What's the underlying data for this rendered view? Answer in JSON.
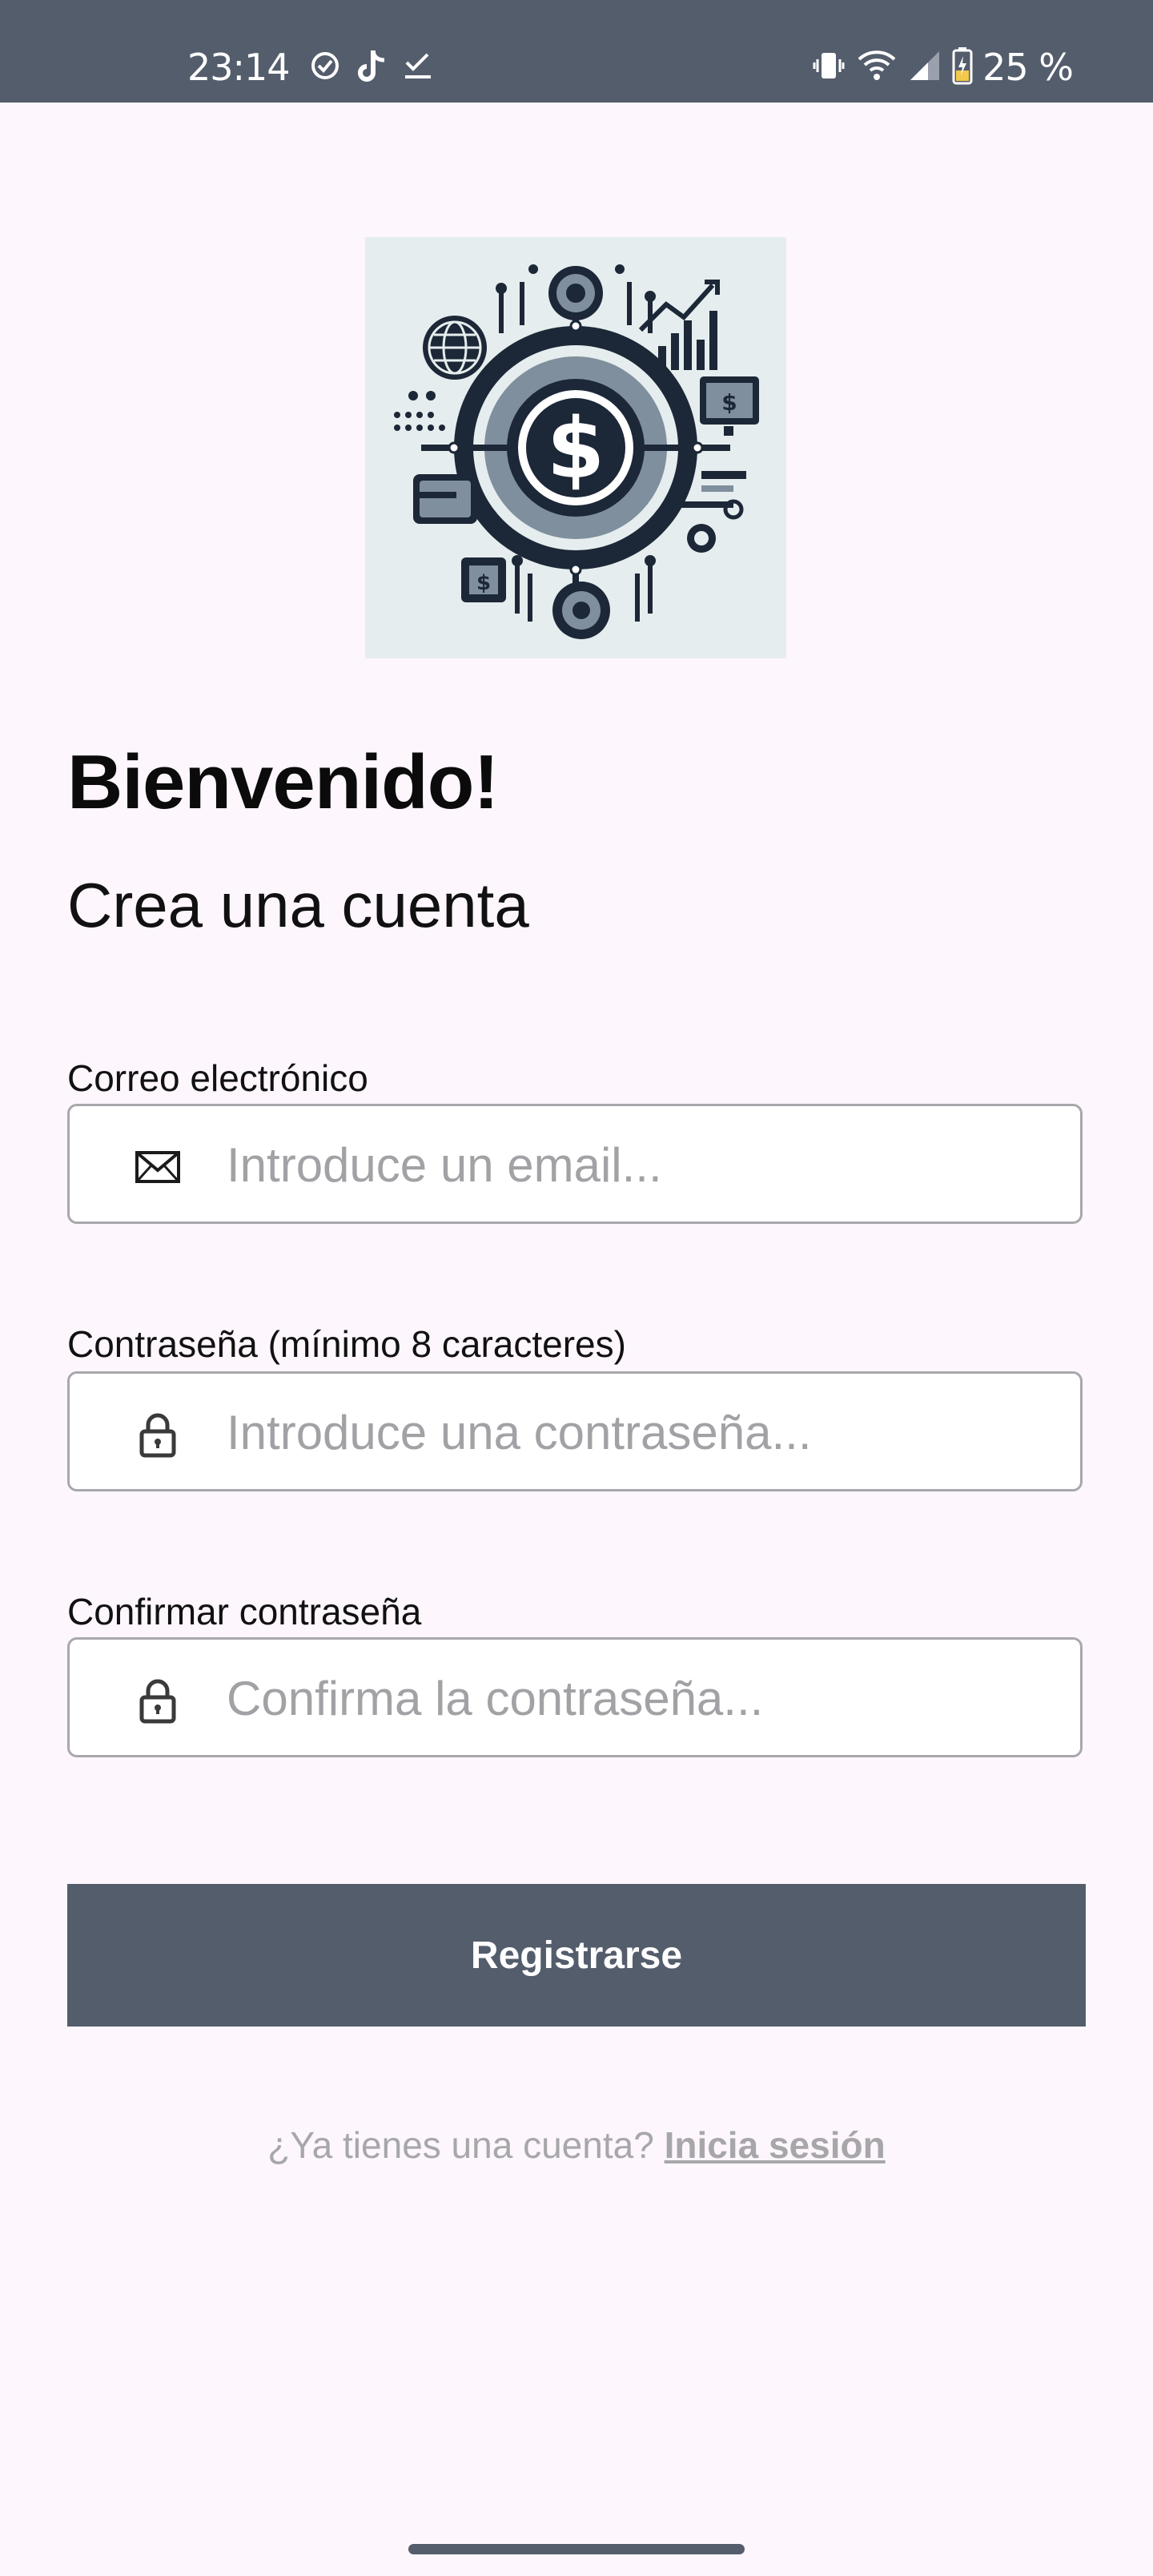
{
  "status_bar": {
    "time": "23:14",
    "battery": "25 %",
    "left_icons": [
      "check-circle-icon",
      "tiktok-icon",
      "tasks-check-icon"
    ],
    "right_icons": [
      "vibrate-icon",
      "wifi-icon",
      "cell-signal-icon",
      "battery-charging-icon"
    ]
  },
  "app": {
    "logo_icon": "finance-dollar-tech-logo"
  },
  "heading": {
    "title": "Bienvenido!",
    "subtitle": "Crea una cuenta"
  },
  "form": {
    "email": {
      "label": "Correo electrónico",
      "placeholder": "Introduce un email...",
      "value": "",
      "icon": "envelope-icon"
    },
    "password": {
      "label": "Contraseña (mínimo 8 caracteres)",
      "placeholder": "Introduce una contraseña...",
      "value": "",
      "icon": "lock-icon"
    },
    "confirm_password": {
      "label": "Confirmar contraseña",
      "placeholder": "Confirma la contraseña...",
      "value": "",
      "icon": "lock-icon"
    },
    "submit_label": "Registrarse"
  },
  "footer": {
    "prompt": "¿Ya tienes una cuenta?",
    "login_link": "Inicia sesión"
  },
  "colors": {
    "background": "#fdf6fd",
    "primary": "#545d6c",
    "placeholder": "#a2a2a6",
    "input_border": "#a8a8ac"
  }
}
